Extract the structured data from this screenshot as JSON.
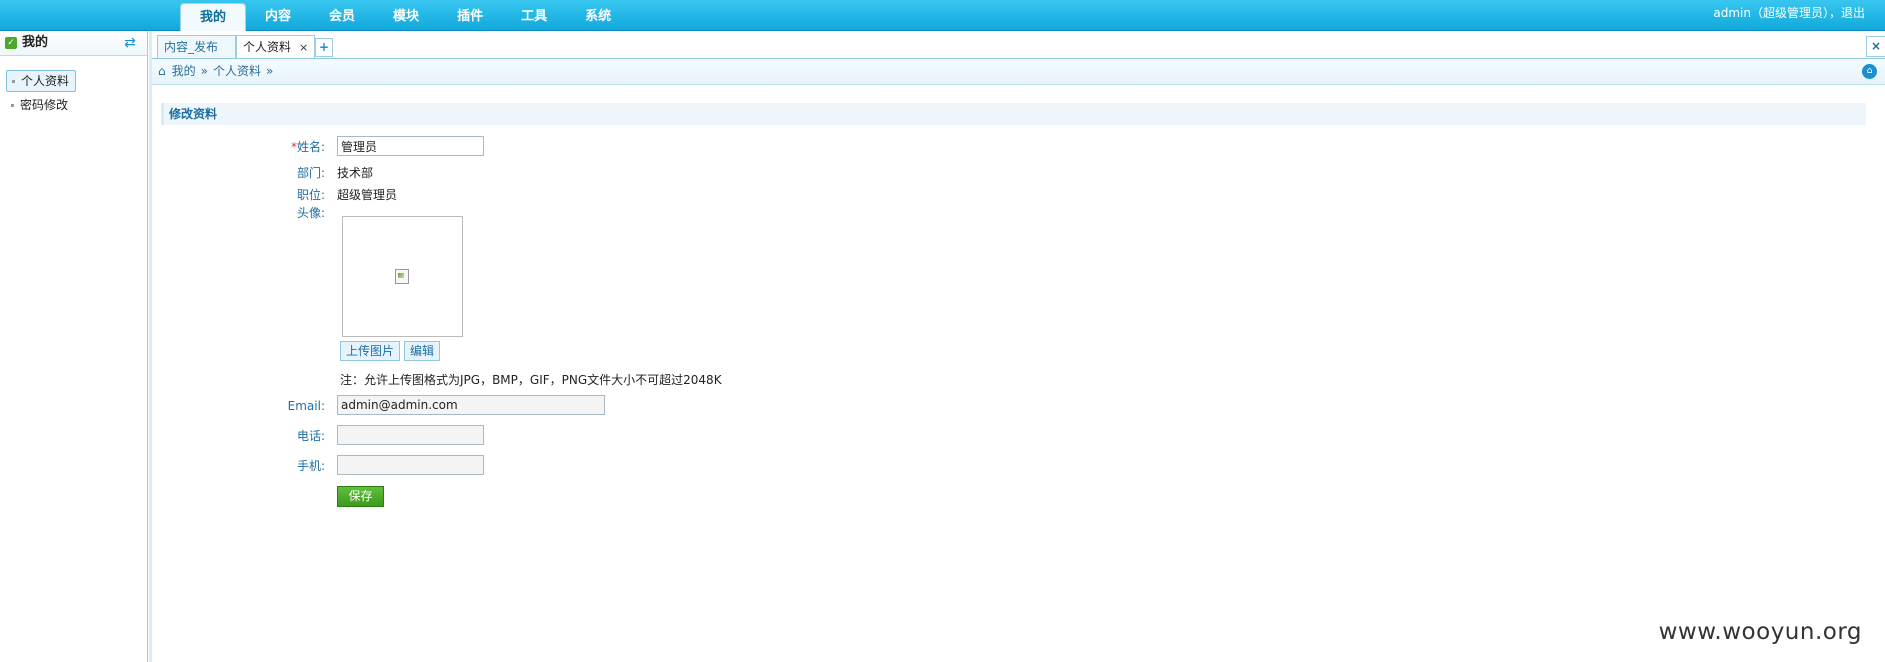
{
  "nav": {
    "items": [
      "我的",
      "内容",
      "会员",
      "模块",
      "插件",
      "工具",
      "系统"
    ],
    "active_index": 0
  },
  "user": {
    "info": "admin（超级管理员），",
    "logout": "退出"
  },
  "left": {
    "title": "我的",
    "items": [
      "个人资料",
      "密码修改"
    ],
    "active_index": 0
  },
  "tabs": {
    "items": [
      {
        "label": "内容_发布"
      },
      {
        "label": "个人资料",
        "closable_icon": "×"
      }
    ],
    "add": "+",
    "close_all": "×"
  },
  "breadcrumb": {
    "items": [
      "我的",
      "个人资料"
    ],
    "separator": "»"
  },
  "form": {
    "section_title": "修改资料",
    "required_mark": "*",
    "name_label": "姓名:",
    "name_value": "管理员",
    "dept_label": "部门:",
    "dept_value": "技术部",
    "position_label": "职位:",
    "position_value": "超级管理员",
    "avatar_label": "头像:",
    "upload_label": "上传图片",
    "edit_label": "编辑",
    "note": "注：允许上传图格式为JPG，BMP，GIF，PNG文件大小不可超过2048K",
    "email_label": "Email:",
    "email_value": "admin@admin.com",
    "phone_label": "电话:",
    "phone_value": "",
    "mobile_label": "手机:",
    "mobile_value": "",
    "save_label": "保存"
  },
  "watermark": "www.wooyun.org",
  "colors": {
    "topbar": "#11a8db",
    "accent_text": "#1c6ea4",
    "save_button": "#4aa82a"
  }
}
